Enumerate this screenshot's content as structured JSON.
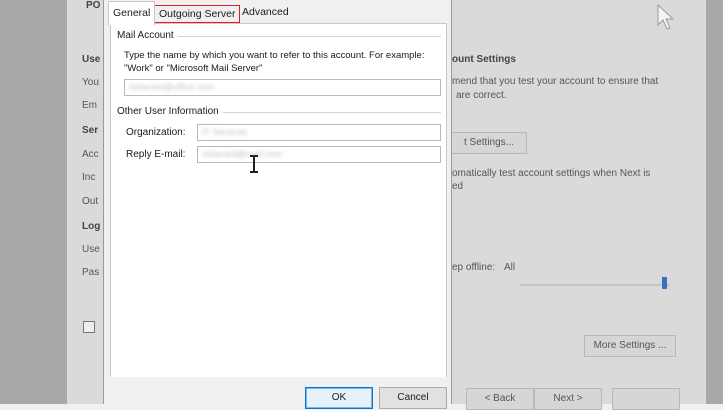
{
  "tabs": {
    "general": "General",
    "outgoing_server": "Outgoing Server",
    "advanced": "Advanced",
    "highlight_color": "#e02020"
  },
  "mail_account": {
    "group_label": "Mail Account",
    "description": "Type the name by which you want to refer to this account. For example: \"Work\" or \"Microsoft Mail Server\"",
    "account_name_value": "redacted@office.com"
  },
  "other_user_info": {
    "group_label": "Other User Information",
    "organization_label": "Organization:",
    "organization_value": "IT Services",
    "reply_email_label": "Reply E-mail:",
    "reply_email_value": "redacted@mail.com"
  },
  "buttons": {
    "ok": "OK",
    "cancel": "Cancel"
  },
  "background_dialog": {
    "title_partial": "PO",
    "section_heading_partial": "ount Settings",
    "recommend_line1": "mend that you test your account to ensure that",
    "recommend_line2": "are correct.",
    "test_settings_button": "t Settings...",
    "auto_test_line1": "omatically test account settings when Next is",
    "auto_test_line2": "ed",
    "keep_offline_label": "ep offline:",
    "keep_offline_value": "All",
    "more_settings_button": "More Settings ...",
    "back_button": "< Back",
    "next_button": "Next >",
    "left_labels": [
      "Use",
      "You",
      "Em",
      "Ser",
      "Acc",
      "Inc",
      "Out",
      "Log",
      "Use",
      "Pas"
    ]
  }
}
